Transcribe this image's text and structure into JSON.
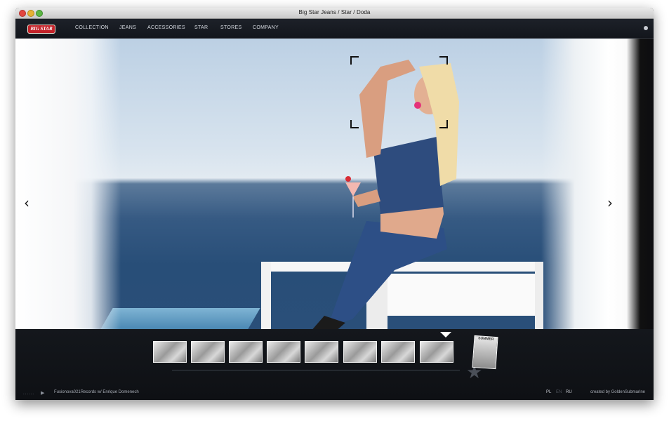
{
  "window": {
    "title": "Big Star Jeans / Star / Doda"
  },
  "brand": {
    "logo_text": "BIG STAR"
  },
  "nav": {
    "items": [
      "COLLECTION",
      "JEANS",
      "ACCESSORIES",
      "STAR",
      "STORES",
      "COMPANY"
    ]
  },
  "gallery": {
    "prev_icon": "chevron-left-icon",
    "next_icon": "chevron-right-icon",
    "prev_glyph": "‹",
    "next_glyph": "›",
    "thumbnail_count": 8,
    "active_index": 7,
    "magazine_text": "SUMMER"
  },
  "footer": {
    "dots": "......",
    "track": "Fusionova021Records w/ Enrique Domenech",
    "languages": [
      "PL",
      "EN",
      "RU"
    ],
    "active_language": "EN",
    "credit": "created by GoldenSubmarine"
  },
  "colors": {
    "brand_red": "#c4232a",
    "bar_dark": "#13161c"
  }
}
